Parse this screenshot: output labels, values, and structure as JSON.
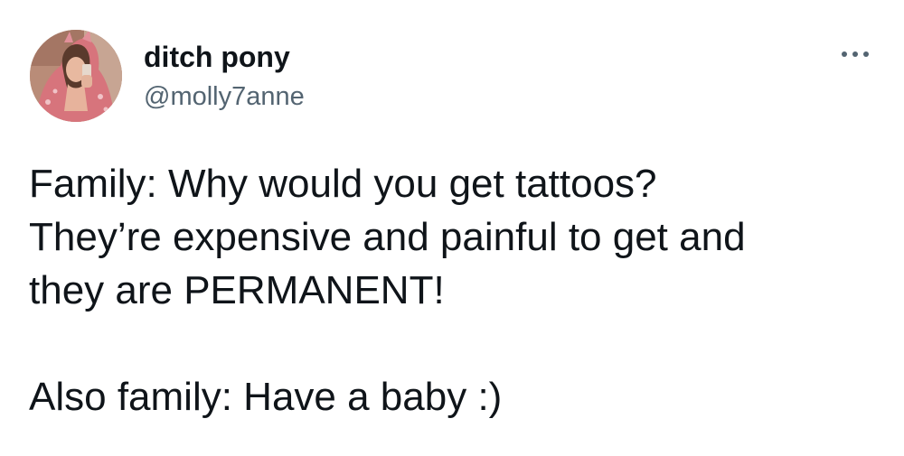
{
  "author": {
    "display_name": "ditch pony",
    "handle": "@molly7anne",
    "avatar_icon": "profile-photo"
  },
  "more_icon": "ellipsis-icon",
  "tweet": {
    "lines": [
      "Family: Why would you get tattoos?",
      "They’re expensive and painful to get and",
      "they are PERMANENT!"
    ],
    "reply_line": "Also family: Have a baby :)"
  },
  "colors": {
    "text_primary": "#0f1419",
    "text_secondary": "#536471",
    "background": "#ffffff"
  }
}
